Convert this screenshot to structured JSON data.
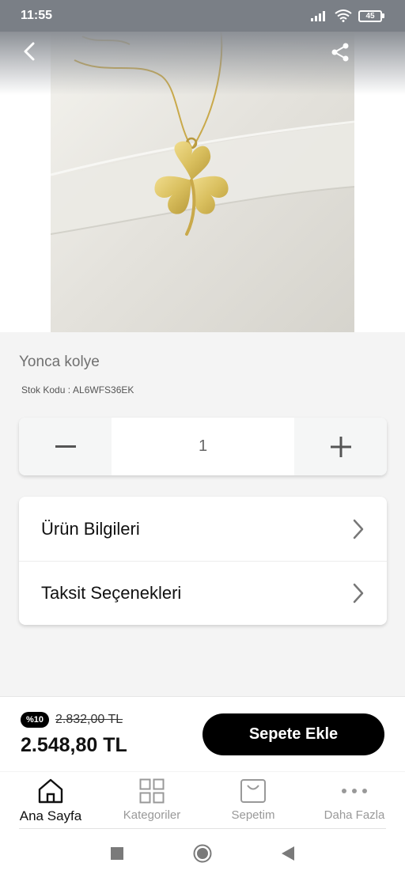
{
  "status_bar": {
    "time": "11:55",
    "battery": "45",
    "icons": [
      "signal-icon",
      "wifi-icon",
      "battery-icon"
    ]
  },
  "header": {
    "back_icon": "chevron-left-icon",
    "share_icon": "share-icon"
  },
  "product": {
    "image": "gold four-leaf clover necklace on white fabric",
    "title": "Yonca kolye",
    "stock_code_label": "Stok Kodu :",
    "stock_code_value": "AL6WFS36EK"
  },
  "quantity": {
    "minus_icon": "minus-icon",
    "value": "1",
    "plus_icon": "plus-icon"
  },
  "info_sections": [
    {
      "label": "Ürün Bilgileri",
      "icon": "chevron-right-icon"
    },
    {
      "label": "Taksit Seçenekleri",
      "icon": "chevron-right-icon"
    }
  ],
  "pricing": {
    "discount_badge": "%10",
    "old_price": "2.832,00 TL",
    "new_price": "2.548,80 TL",
    "add_to_cart_label": "Sepete Ekle"
  },
  "bottom_nav": [
    {
      "label": "Ana Sayfa",
      "icon": "home-icon",
      "active": true
    },
    {
      "label": "Kategoriler",
      "icon": "grid-icon",
      "active": false
    },
    {
      "label": "Sepetim",
      "icon": "shopping-bag-icon",
      "active": false
    },
    {
      "label": "Daha Fazla",
      "icon": "more-dots-icon",
      "active": false
    }
  ],
  "system_nav": [
    "recent-apps-icon",
    "home-circle-icon",
    "back-triangle-icon"
  ],
  "colors": {
    "primary": "#000000",
    "background": "#f4f4f4",
    "status_bar": "#7a7f86",
    "muted_text": "#999999"
  }
}
